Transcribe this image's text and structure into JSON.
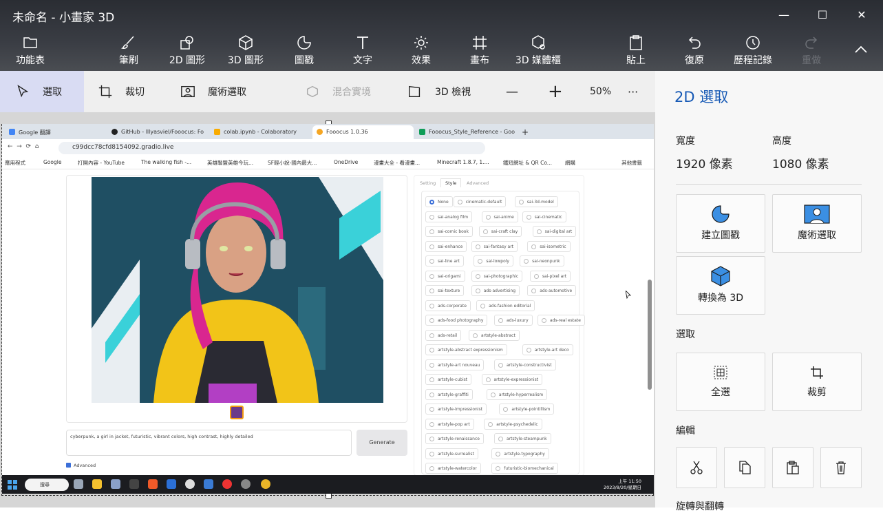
{
  "window": {
    "title": "未命名 - 小畫家 3D",
    "minimize": "—",
    "maximize": "☐",
    "close": "✕"
  },
  "ribbon": {
    "menu": "功能表",
    "brushes": "筆刷",
    "shapes2d": "2D 圖形",
    "shapes3d": "3D 圖形",
    "stickers": "圖戳",
    "text": "文字",
    "effects": "效果",
    "canvas": "畫布",
    "library3d": "3D 媒體櫃",
    "paste": "貼上",
    "undo": "復原",
    "history": "歷程記錄",
    "redo": "重做"
  },
  "toolbar": {
    "select": "選取",
    "crop": "裁切",
    "magic_select": "魔術選取",
    "mixed_reality": "混合實境",
    "view3d": "3D 檢視",
    "zoom_out": "—",
    "zoom_in": "+",
    "zoom": "50%",
    "more": "···"
  },
  "side": {
    "title": "2D 選取",
    "width_label": "寬度",
    "height_label": "高度",
    "width_value": "1920 像素",
    "height_value": "1080 像素",
    "make_sticker": "建立圖戳",
    "magic_select": "魔術選取",
    "convert_3d": "轉換為 3D",
    "select_section": "選取",
    "select_all": "全選",
    "crop": "裁剪",
    "edit_section": "編輯",
    "rotate_section": "旋轉與翻轉"
  },
  "browser": {
    "tabs": [
      {
        "label": "Google 翻譯",
        "color": "#4285f4"
      },
      {
        "label": "GitHub - lllyasviel/Fooocus: Fo",
        "color": "#222222"
      },
      {
        "label": "colab.ipynb - Colaboratory",
        "color": "#f9ab00"
      },
      {
        "label": "Fooocus 1.0.36",
        "color": "#f5a623"
      },
      {
        "label": "Fooocus_Style_Reference - Goo",
        "color": "#0f9d58"
      }
    ],
    "url": "c99dcc78cfd8154092.gradio.live",
    "bookmarks": [
      "應用程式",
      "Google",
      "打開內容 - YouTube",
      "The walking fish -...",
      "英雄聯盟英雄今玩...",
      "SF輕小說-國內最大...",
      "OneDrive",
      "漫畫大全 - 看漫畫...",
      "Minecraft 1.8.7, 1....",
      "鐵短網址 & QR Co...",
      "網購",
      "其他書籤"
    ],
    "style_tabs": [
      "Setting",
      "Style",
      "Advanced"
    ],
    "styles": [
      [
        "None",
        "cinematic-default",
        "sai-3d-model"
      ],
      [
        "sai-analog film",
        "sai-anime",
        "sai-cinematic"
      ],
      [
        "sai-comic book",
        "sai-craft clay",
        "sai-digital art"
      ],
      [
        "sai-enhance",
        "sai-fantasy art",
        "sai-isometric"
      ],
      [
        "sai-line art",
        "sai-lowpoly",
        "sai-neonpunk"
      ],
      [
        "sai-origami",
        "sai-photographic",
        "sai-pixel art"
      ],
      [
        "sai-texture",
        "ads-advertising",
        "ads-automotive"
      ],
      [
        "ads-corporate",
        "ads-fashion editorial"
      ],
      [
        "ads-food photography",
        "ads-luxury",
        "ads-real estate"
      ],
      [
        "ads-retail",
        "artstyle-abstract"
      ],
      [
        "artstyle-abstract expressionism",
        "artstyle-art deco"
      ],
      [
        "artstyle-art nouveau",
        "artstyle-constructivist"
      ],
      [
        "artstyle-cubist",
        "artstyle-expressionist"
      ],
      [
        "artstyle-graffiti",
        "artstyle-hyperrealism"
      ],
      [
        "artstyle-impressionist",
        "artstyle-pointillism"
      ],
      [
        "artstyle-pop art",
        "artstyle-psychedelic"
      ],
      [
        "artstyle-renaissance",
        "artstyle-steampunk"
      ],
      [
        "artstyle-surrealist",
        "artstyle-typography"
      ],
      [
        "artstyle-watercolor",
        "futuristic-biomechanical"
      ]
    ],
    "prompt": "cyberpunk, a girl in jacket, futuristic, vibrant colors, high contrast, highly detailed",
    "generate": "Generate",
    "advanced": "Advanced",
    "search": "搜尋",
    "time": "上午 11:50",
    "date": "2023/8/20/星期日"
  }
}
